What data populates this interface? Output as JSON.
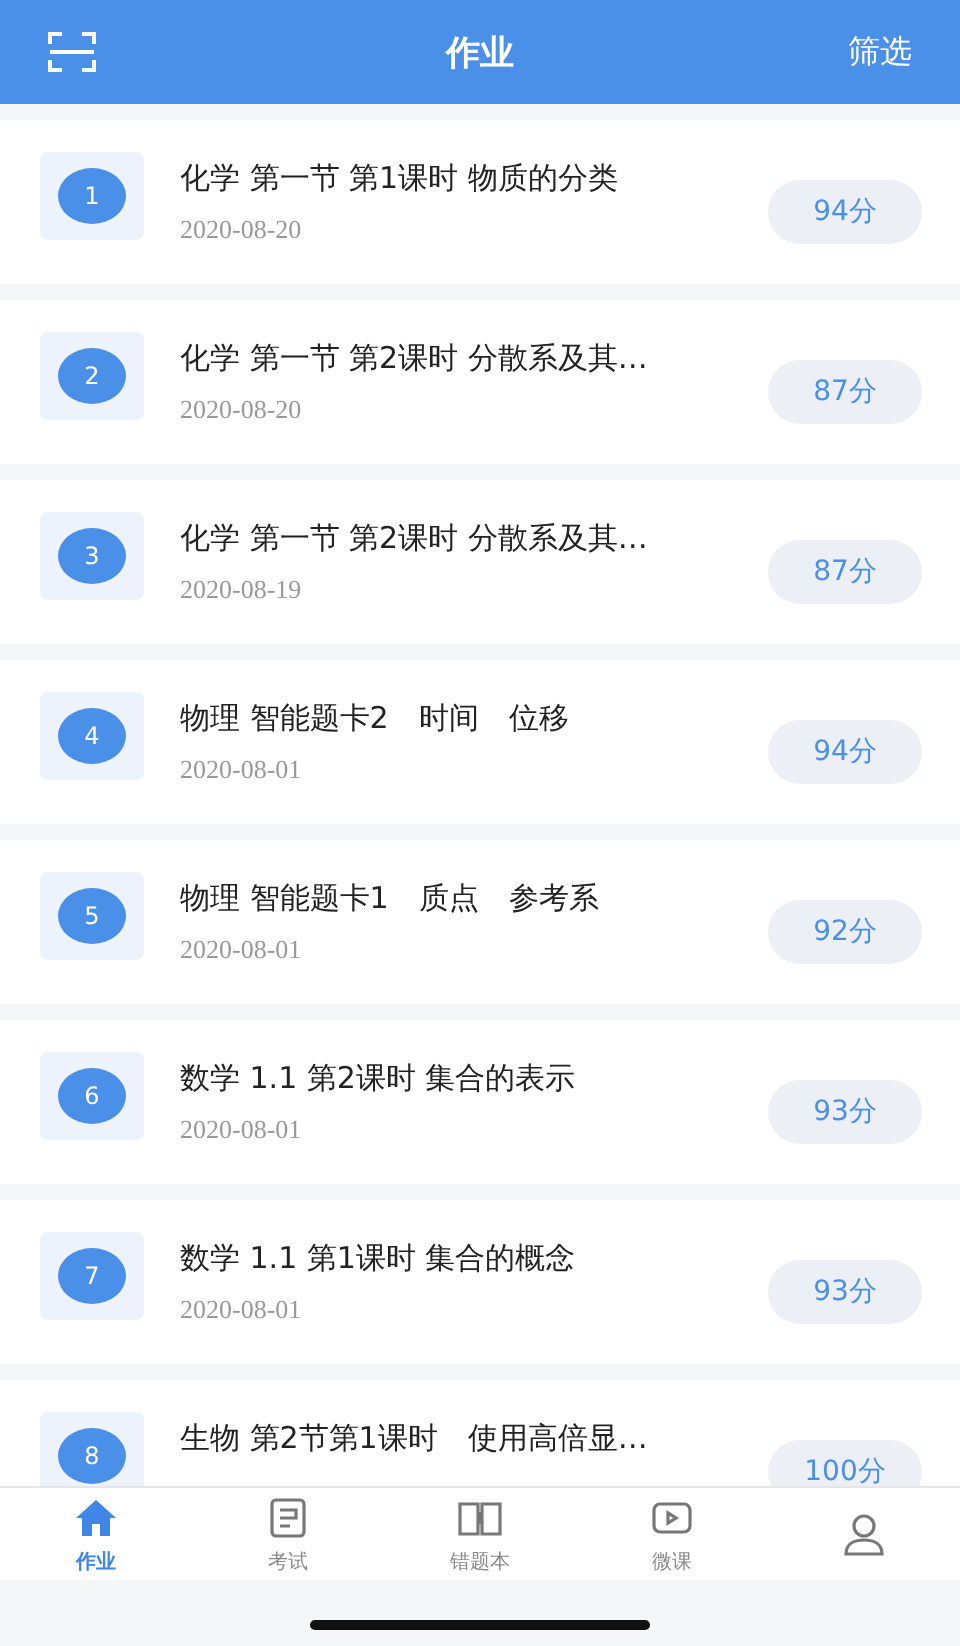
{
  "header": {
    "title": "作业",
    "filter": "筛选"
  },
  "assignments": [
    {
      "number": "1",
      "title": "化学  第一节 第1课时 物质的分类",
      "date": "2020-08-20",
      "score": "94分"
    },
    {
      "number": "2",
      "title": "化学  第一节 第2课时 分散系及其…",
      "date": "2020-08-20",
      "score": "87分"
    },
    {
      "number": "3",
      "title": "化学  第一节 第2课时 分散系及其…",
      "date": "2020-08-19",
      "score": "87分"
    },
    {
      "number": "4",
      "title": "物理  智能题卡2　时间　位移",
      "date": "2020-08-01",
      "score": "94分"
    },
    {
      "number": "5",
      "title": "物理  智能题卡1　质点　参考系",
      "date": "2020-08-01",
      "score": "92分"
    },
    {
      "number": "6",
      "title": "数学  1.1 第2课时 集合的表示",
      "date": "2020-08-01",
      "score": "93分"
    },
    {
      "number": "7",
      "title": "数学  1.1 第1课时 集合的概念",
      "date": "2020-08-01",
      "score": "93分"
    },
    {
      "number": "8",
      "title": "生物  第2节第1课时　使用高倍显…",
      "score": "100分"
    }
  ],
  "tabs": [
    {
      "kind": "home",
      "label": "作业",
      "selected": true
    },
    {
      "kind": "exam",
      "label": "考试",
      "selected": false
    },
    {
      "kind": "book",
      "label": "错题本",
      "selected": false
    },
    {
      "kind": "video",
      "label": "微课",
      "selected": false
    },
    {
      "kind": "user",
      "selected": false
    }
  ]
}
